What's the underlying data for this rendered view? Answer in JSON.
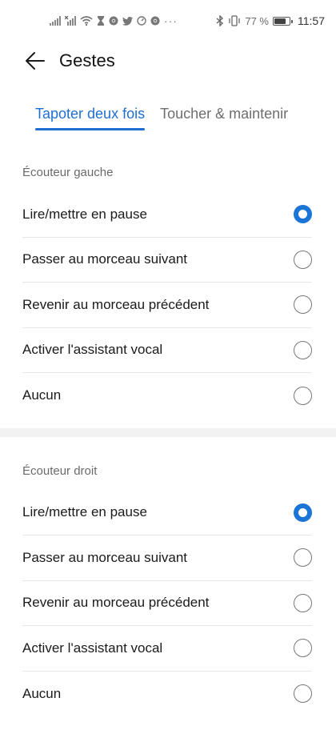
{
  "status_bar": {
    "battery_percent": "77 %",
    "battery_level": 0.77,
    "time": "11:57",
    "icons_left": [
      "signal-icon",
      "no-signal-icon",
      "wifi-icon",
      "hourglass-icon",
      "chrome-icon",
      "twitter-icon",
      "speedometer-icon",
      "chrome-icon"
    ],
    "icons_right": [
      "bluetooth-icon",
      "vibrate-icon",
      "battery-icon"
    ]
  },
  "app_bar": {
    "title": "Gestes",
    "back_icon": "arrow-left-icon"
  },
  "tabs": [
    {
      "label": "Tapoter deux fois",
      "active": true
    },
    {
      "label": "Toucher & maintenir",
      "active": false
    }
  ],
  "sections": [
    {
      "header": "Écouteur gauche",
      "options": [
        {
          "label": "Lire/mettre en pause",
          "checked": true
        },
        {
          "label": "Passer au morceau suivant",
          "checked": false
        },
        {
          "label": "Revenir au morceau précédent",
          "checked": false
        },
        {
          "label": "Activer l'assistant vocal",
          "checked": false
        },
        {
          "label": "Aucun",
          "checked": false
        }
      ]
    },
    {
      "header": "Écouteur droit",
      "options": [
        {
          "label": "Lire/mettre en pause",
          "checked": true
        },
        {
          "label": "Passer au morceau suivant",
          "checked": false
        },
        {
          "label": "Revenir au morceau précédent",
          "checked": false
        },
        {
          "label": "Activer l'assistant vocal",
          "checked": false
        },
        {
          "label": "Aucun",
          "checked": false
        }
      ]
    }
  ],
  "colors": {
    "accent": "#1f6fd1",
    "radio_checked": "#1a75d6"
  }
}
